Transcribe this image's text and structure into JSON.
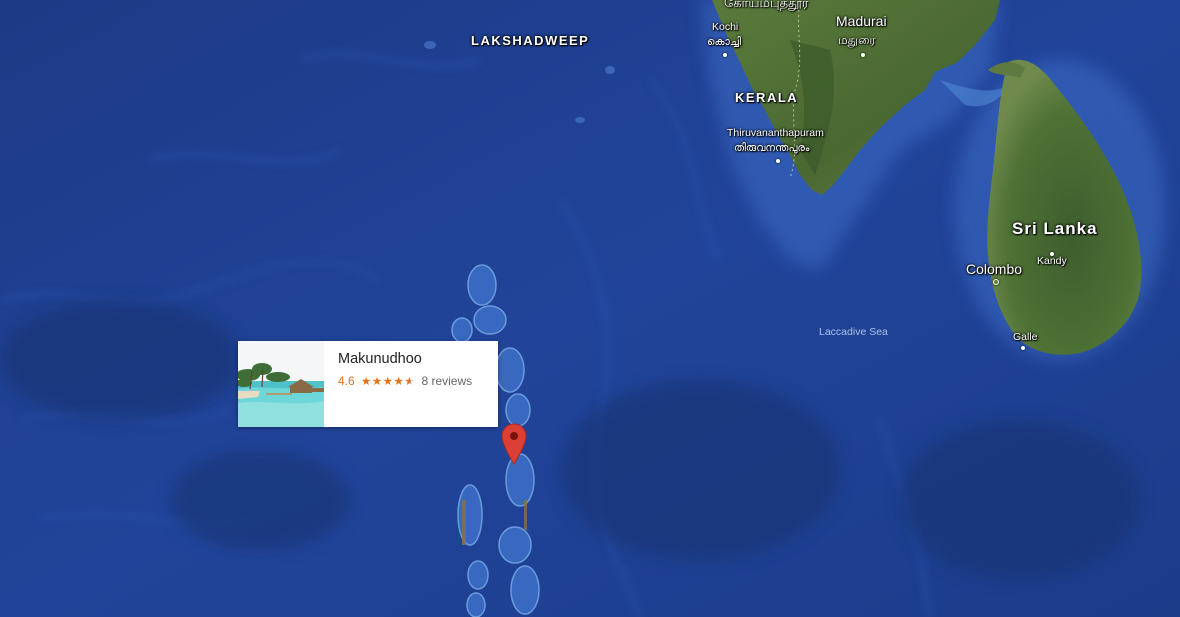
{
  "map": {
    "view": "satellite",
    "place_labels": {
      "kovaipudur": "கோயமபுததூர",
      "madurai": "Madurai",
      "madurai_local": "மதுரை",
      "kochi": "Kochi",
      "kochi_local": "കൊച്ചി",
      "lakshadweep": "LAKSHADWEEP",
      "kerala": "KERALA",
      "thiruvananthapuram": "Thiruvananthapuram",
      "thiruvananthapuram_local": "തിരുവനന്തപുരം",
      "sri_lanka": "Sri Lanka",
      "kandy": "Kandy",
      "colombo": "Colombo",
      "galle": "Galle",
      "laccadive_sea": "Laccadive Sea"
    }
  },
  "info_card": {
    "title": "Makunudhoo",
    "rating": "4.6",
    "stars": "★★★★★",
    "rating_value": 4.6,
    "rating_max": 5,
    "reviews": "8 reviews"
  },
  "marker": {
    "icon": "map-pin-icon",
    "color": "#db3f35"
  },
  "colors": {
    "ocean": "#1e3f8c",
    "land": "#4f6c36",
    "rating": "#e7711b"
  }
}
